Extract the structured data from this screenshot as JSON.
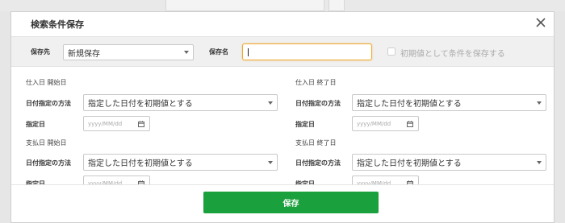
{
  "dialog": {
    "title": "検索条件保存",
    "close_icon": "close-icon"
  },
  "top_bar": {
    "destination_label": "保存先",
    "destination_value": "新規保存",
    "name_label": "保存名",
    "name_value": "",
    "default_checkbox_label": "初期値として条件を保存する",
    "default_checked": false
  },
  "sections": [
    {
      "heading": "仕入日 開始日",
      "method_label": "日付指定の方法",
      "method_value": "指定した日付を初期値とする",
      "date_label": "指定日",
      "date_placeholder": "yyyy/MM/dd"
    },
    {
      "heading": "仕入日 終了日",
      "method_label": "日付指定の方法",
      "method_value": "指定した日付を初期値とする",
      "date_label": "指定日",
      "date_placeholder": "yyyy/MM/dd"
    },
    {
      "heading": "支払日 開始日",
      "method_label": "日付指定の方法",
      "method_value": "指定した日付を初期値とする",
      "date_label": "指定日",
      "date_placeholder": "yyyy/MM/dd"
    },
    {
      "heading": "支払日 終了日",
      "method_label": "日付指定の方法",
      "method_value": "指定した日付を初期値とする",
      "date_label": "指定日",
      "date_placeholder": "yyyy/MM/dd"
    }
  ],
  "footer": {
    "save_label": "保存"
  },
  "colors": {
    "accent_green": "#1aa03c",
    "focus_orange": "#f0a830"
  }
}
